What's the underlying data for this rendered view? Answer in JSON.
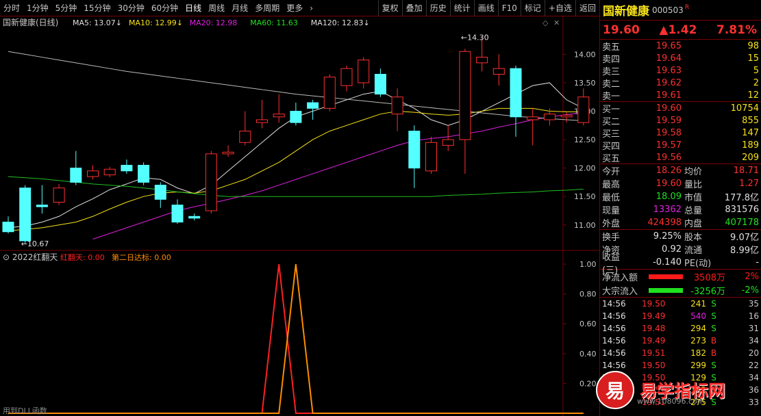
{
  "periods": [
    "分时",
    "1分钟",
    "5分钟",
    "15分钟",
    "30分钟",
    "60分钟",
    "日线",
    "周线",
    "月线",
    "多周期",
    "更多"
  ],
  "active_period": "日线",
  "tools": [
    "复权",
    "叠加",
    "历史",
    "统计",
    "画线",
    "F10",
    "标记",
    "+自选",
    "返回"
  ],
  "stock": {
    "name": "国新健康",
    "code": "000503",
    "r": "R",
    "price": "19.60",
    "change": "▲1.42",
    "pct": "7.81%"
  },
  "asks": [
    {
      "l": "卖五",
      "p": "19.65",
      "v": "98"
    },
    {
      "l": "卖四",
      "p": "19.64",
      "v": "15"
    },
    {
      "l": "卖三",
      "p": "19.63",
      "v": "5"
    },
    {
      "l": "卖二",
      "p": "19.62",
      "v": "2"
    },
    {
      "l": "卖一",
      "p": "19.61",
      "v": "12"
    }
  ],
  "bids": [
    {
      "l": "买一",
      "p": "19.60",
      "v": "10754"
    },
    {
      "l": "买二",
      "p": "19.59",
      "v": "855"
    },
    {
      "l": "买三",
      "p": "19.58",
      "v": "147"
    },
    {
      "l": "买四",
      "p": "19.57",
      "v": "189"
    },
    {
      "l": "买五",
      "p": "19.56",
      "v": "209"
    }
  ],
  "stats": [
    {
      "l": "今开",
      "v": "18.26",
      "l2": "均价",
      "v2": "18.71"
    },
    {
      "l": "最高",
      "v": "19.60",
      "l2": "量比",
      "v2": "1.27"
    },
    {
      "l": "最低",
      "v": "18.09",
      "l2": "市值",
      "v2": "177.8亿"
    },
    {
      "l": "现量",
      "v": "13362",
      "l2": "总量",
      "v2": "831576"
    },
    {
      "l": "外盘",
      "v": "424398",
      "l2": "内盘",
      "v2": "407178"
    }
  ],
  "stats2": [
    {
      "l": "换手",
      "v": "9.25%",
      "l2": "股本",
      "v2": "9.07亿"
    },
    {
      "l": "净资",
      "v": "0.92",
      "l2": "流通",
      "v2": "8.99亿"
    },
    {
      "l": "收益(三)",
      "v": "-0.140",
      "l2": "PE(动)",
      "v2": "-"
    }
  ],
  "flows": [
    {
      "l": "净流入额",
      "v": "3508万",
      "p": "2%",
      "color": "#ff1a1a"
    },
    {
      "l": "大宗流入",
      "v": "-3256万",
      "p": "-2%",
      "color": "#20e020"
    }
  ],
  "ticks": [
    {
      "t": "14:56",
      "p": "19.50",
      "v": "241",
      "d": "S",
      "n": "35"
    },
    {
      "t": "14:56",
      "p": "19.49",
      "v": "540",
      "d": "S",
      "n": "16"
    },
    {
      "t": "14:56",
      "p": "19.48",
      "v": "294",
      "d": "S",
      "n": "31"
    },
    {
      "t": "14:56",
      "p": "19.49",
      "v": "273",
      "d": "B",
      "n": "34"
    },
    {
      "t": "14:56",
      "p": "19.51",
      "v": "182",
      "d": "B",
      "n": "20"
    },
    {
      "t": "14:56",
      "p": "19.50",
      "v": "299",
      "d": "S",
      "n": "22"
    },
    {
      "t": "14:56",
      "p": "19.50",
      "v": "129",
      "d": "S",
      "n": "34"
    },
    {
      "t": "",
      "p": "19.51",
      "v": "152",
      "d": "B",
      "n": "36"
    },
    {
      "t": "",
      "p": "19.51",
      "v": "275",
      "d": "S",
      "n": "33"
    }
  ],
  "chart_title": "国新健康(日线)",
  "ma": [
    {
      "l": "MA5: 13.07",
      "c": "#e0e0e0"
    },
    {
      "l": "MA10: 12.99",
      "c": "#f7e21a"
    },
    {
      "l": "MA20: 12.98",
      "c": "#e020e0"
    },
    {
      "l": "MA60: 11.63",
      "c": "#20e020"
    },
    {
      "l": "MA120: 12.83",
      "c": "#e0e0e0"
    }
  ],
  "ind_title": "2022红翻天",
  "ind_labels": [
    {
      "l": "红翻天: 0.00",
      "c": "#ff2020"
    },
    {
      "l": "第二日达标: 0.00",
      "c": "#ff8c00"
    }
  ],
  "bottom_text": "用到DLL函数",
  "chart_data": {
    "type": "candlestick",
    "y_ticks": [
      11.0,
      11.5,
      12.0,
      12.5,
      13.0,
      13.5,
      14.0
    ],
    "ind_ticks": [
      0.2,
      0.4,
      0.6,
      0.8,
      1.0
    ],
    "max_label": "14.30",
    "min_label": "10.67",
    "candles": [
      [
        11.05,
        10.88,
        11.15,
        10.85
      ],
      [
        11.65,
        10.72,
        11.7,
        10.67
      ],
      [
        11.35,
        11.32,
        11.7,
        11.2
      ],
      [
        11.4,
        11.65,
        11.72,
        11.35
      ],
      [
        12.0,
        11.75,
        12.3,
        11.7
      ],
      [
        11.85,
        11.95,
        12.05,
        11.8
      ],
      [
        11.88,
        11.98,
        12.02,
        11.84
      ],
      [
        12.05,
        11.95,
        12.15,
        11.9
      ],
      [
        12.05,
        11.75,
        12.1,
        11.7
      ],
      [
        11.7,
        11.45,
        11.75,
        11.3
      ],
      [
        11.35,
        11.05,
        11.45,
        11.02
      ],
      [
        11.15,
        11.12,
        11.2,
        11.08
      ],
      [
        11.25,
        12.25,
        12.3,
        11.2
      ],
      [
        12.25,
        12.28,
        12.4,
        12.2
      ],
      [
        12.45,
        12.65,
        13.0,
        12.4
      ],
      [
        12.8,
        12.85,
        13.2,
        12.7
      ],
      [
        12.9,
        12.95,
        13.3,
        12.8
      ],
      [
        13.0,
        12.8,
        13.15,
        12.75
      ],
      [
        13.15,
        13.05,
        13.2,
        12.85
      ],
      [
        13.05,
        13.6,
        13.65,
        13.0
      ],
      [
        13.45,
        13.75,
        13.8,
        13.35
      ],
      [
        13.5,
        13.9,
        13.95,
        13.4
      ],
      [
        13.65,
        13.3,
        13.75,
        13.25
      ],
      [
        12.95,
        13.25,
        13.4,
        12.65
      ],
      [
        12.65,
        12.0,
        12.75,
        11.65
      ],
      [
        11.95,
        12.45,
        12.55,
        11.9
      ],
      [
        12.4,
        12.5,
        12.75,
        12.3
      ],
      [
        12.5,
        14.05,
        14.1,
        11.9
      ],
      [
        13.85,
        13.95,
        14.3,
        13.7
      ],
      [
        13.65,
        13.75,
        14.0,
        13.45
      ],
      [
        13.75,
        12.9,
        13.8,
        12.55
      ],
      [
        12.85,
        12.9,
        13.05,
        12.4
      ],
      [
        12.85,
        12.95,
        13.05,
        12.75
      ],
      [
        12.9,
        12.93,
        12.98,
        12.8
      ],
      [
        12.8,
        13.25,
        13.4,
        12.75
      ]
    ],
    "series": [
      {
        "name": "MA5",
        "values": [
          10.95,
          10.98,
          11.05,
          11.15,
          11.32,
          11.46,
          11.62,
          11.72,
          11.83,
          11.8,
          11.65,
          11.55,
          11.7,
          11.95,
          12.2,
          12.45,
          12.7,
          12.9,
          13.0,
          13.1,
          13.2,
          13.3,
          13.35,
          13.2,
          13.05,
          12.85,
          12.75,
          12.85,
          13.0,
          13.15,
          13.3,
          13.45,
          13.5,
          13.2,
          13.05
        ]
      },
      {
        "name": "MA10",
        "values": [
          10.9,
          10.92,
          10.95,
          11.0,
          11.05,
          11.15,
          11.28,
          11.4,
          11.5,
          11.56,
          11.58,
          11.56,
          11.6,
          11.7,
          11.8,
          11.95,
          12.1,
          12.3,
          12.5,
          12.65,
          12.75,
          12.85,
          12.95,
          13.0,
          12.98,
          12.95,
          12.93,
          12.95,
          13.0,
          13.05,
          13.05,
          13.05,
          13.0,
          12.99,
          12.99
        ]
      },
      {
        "name": "MA20",
        "values": [
          null,
          null,
          null,
          null,
          null,
          10.75,
          10.85,
          10.95,
          11.05,
          11.15,
          11.25,
          11.32,
          11.38,
          11.45,
          11.52,
          11.6,
          11.7,
          11.8,
          11.9,
          12.0,
          12.1,
          12.2,
          12.3,
          12.4,
          12.48,
          12.52,
          12.55,
          12.6,
          12.65,
          12.72,
          12.78,
          12.85,
          12.9,
          12.94,
          12.98
        ]
      },
      {
        "name": "MA60",
        "values": [
          11.85,
          11.83,
          11.81,
          11.78,
          11.75,
          11.72,
          11.7,
          11.68,
          11.65,
          11.62,
          11.58,
          11.55,
          11.52,
          11.5,
          11.5,
          11.5,
          11.5,
          11.5,
          11.5,
          11.5,
          11.5,
          11.5,
          11.5,
          11.5,
          11.5,
          11.5,
          11.52,
          11.53,
          11.54,
          11.56,
          11.57,
          11.58,
          11.6,
          11.61,
          11.63
        ]
      },
      {
        "name": "MA120",
        "values": [
          14.05,
          14.0,
          13.95,
          13.9,
          13.85,
          13.8,
          13.75,
          13.7,
          13.66,
          13.62,
          13.58,
          13.54,
          13.5,
          13.46,
          13.42,
          13.38,
          13.34,
          13.3,
          13.27,
          13.24,
          13.21,
          13.18,
          13.15,
          13.12,
          13.09,
          13.06,
          13.03,
          13.0,
          12.97,
          12.94,
          12.91,
          12.89,
          12.87,
          12.85,
          12.83
        ]
      }
    ],
    "indicator": [
      {
        "name": "红翻天",
        "values": [
          0,
          0,
          0,
          0,
          0,
          0,
          0,
          0,
          0,
          0,
          0,
          0,
          0,
          0,
          0,
          0,
          1,
          0,
          0,
          0,
          0,
          0,
          0,
          0,
          0,
          0,
          0,
          0,
          0,
          0,
          0,
          0,
          0,
          0,
          0
        ]
      },
      {
        "name": "第二日达标",
        "values": [
          0,
          0,
          0,
          0,
          0,
          0,
          0,
          0,
          0,
          0,
          0,
          0,
          0,
          0,
          0,
          0,
          0,
          1,
          0,
          0,
          0,
          0,
          0,
          0,
          0,
          0,
          0,
          0,
          0,
          0,
          0,
          0,
          0,
          0,
          0
        ]
      }
    ]
  }
}
